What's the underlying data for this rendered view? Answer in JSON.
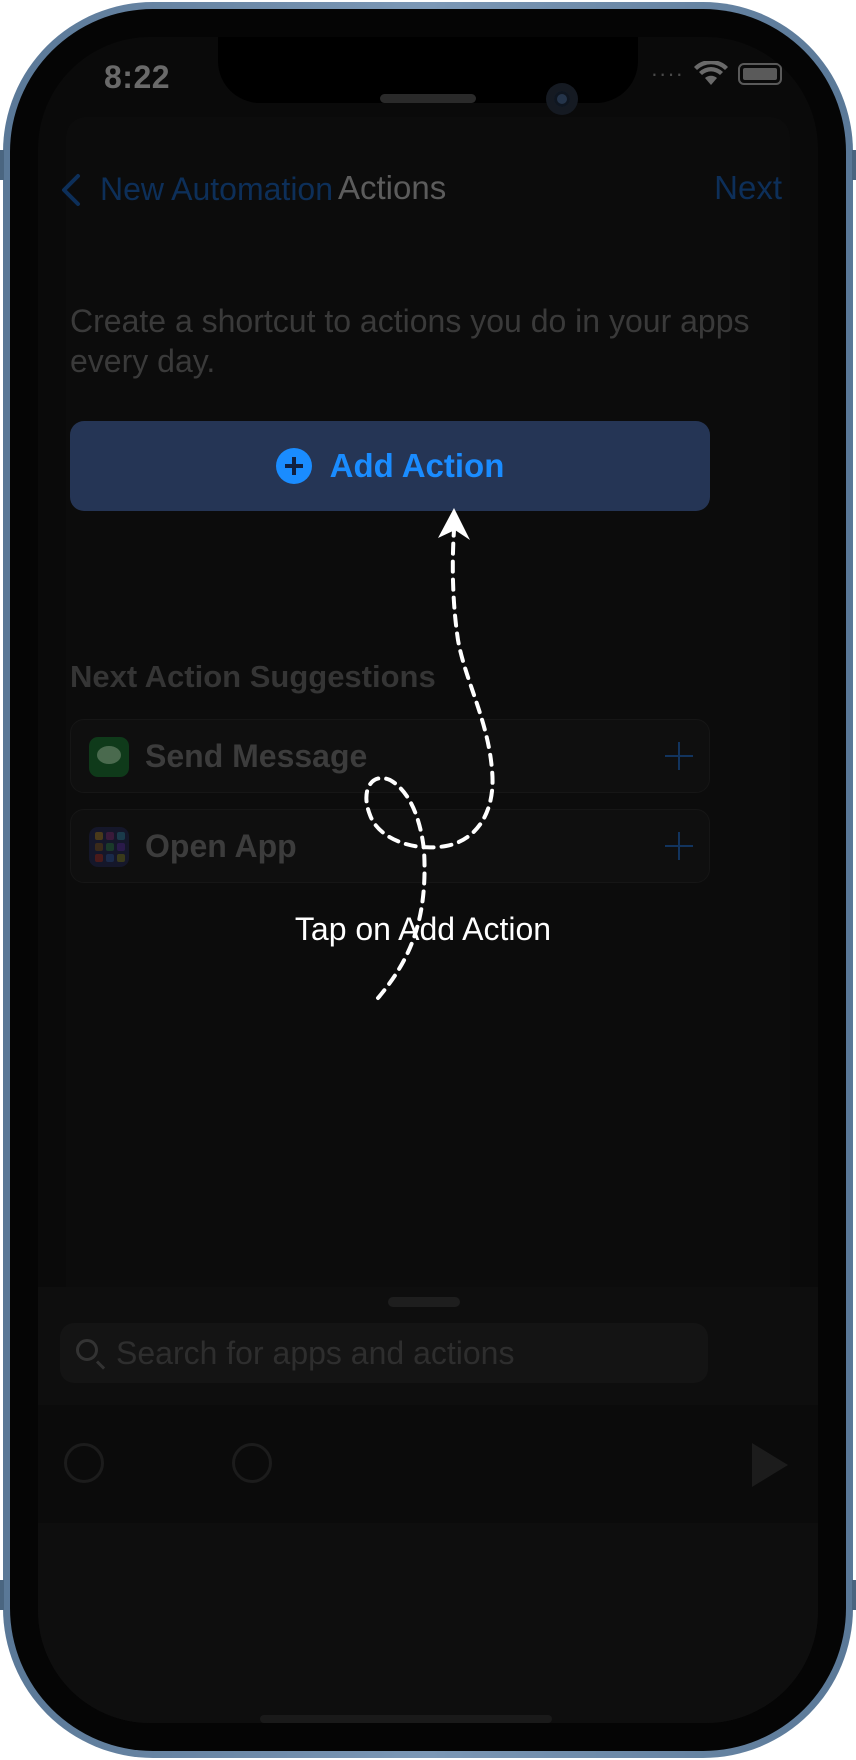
{
  "status_bar": {
    "time": "8:22",
    "signal": "····"
  },
  "nav": {
    "back_label": "New Automation",
    "title": "Actions",
    "next_label": "Next"
  },
  "intro_text": "Create a shortcut to actions you do in your apps every day.",
  "add_action_label": "Add Action",
  "suggestions": {
    "title": "Next Action Suggestions",
    "items": [
      {
        "label": "Send Message",
        "icon": "messages-icon"
      },
      {
        "label": "Open App",
        "icon": "app-grid-icon"
      }
    ]
  },
  "search": {
    "placeholder": "Search for apps and actions"
  },
  "tutorial_caption": "Tap on Add Action",
  "colors": {
    "accent": "#1a8cff",
    "button_bg": "#253555",
    "frame": "#6f8cab"
  }
}
